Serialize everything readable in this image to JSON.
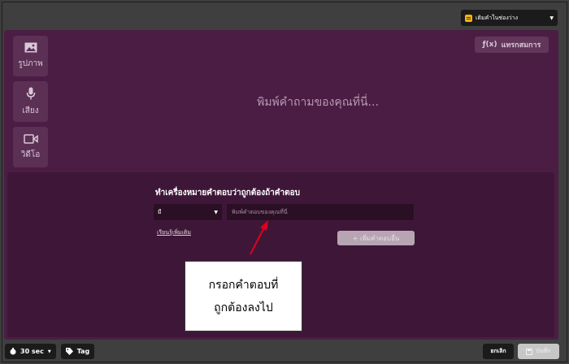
{
  "header": {
    "question_type": "เติมคำในช่องว่าง",
    "question_type_icon": "fill-blank-icon"
  },
  "sidebar": {
    "items": [
      {
        "label": "รูปภาพ",
        "icon": "image-icon"
      },
      {
        "label": "เสียง",
        "icon": "microphone-icon"
      },
      {
        "label": "วิดีโอ",
        "icon": "video-icon"
      }
    ]
  },
  "editor": {
    "equation_label": "แทรกสมการ",
    "equation_icon_text": "ƒ(x)",
    "question_placeholder": "พิมพ์คำถามของคุณที่นี่..."
  },
  "answer": {
    "title": "ทำเครื่องหมายคำตอบว่าถูกต้องถ้าคำตอบ",
    "condition_value": "มี",
    "input_placeholder": "พิมพ์คำตอบของคุณที่นี่",
    "learn_more": "เรียนรู้เพิ่มเติม",
    "add_answer_label": "+ เพิ่มคำตอบอื่น"
  },
  "annotation": {
    "line1": "กรอกคำตอบที่",
    "line2": "ถูกต้องลงไป"
  },
  "footer": {
    "timer": "30 sec",
    "tag": "Tag",
    "cancel": "ยกเลิก",
    "save": "บันทึก"
  },
  "colors": {
    "panel": "#4b1d44",
    "answer_area": "#3e1738",
    "annotation_arrow": "#e0001b",
    "type_icon": "#f2b416"
  }
}
